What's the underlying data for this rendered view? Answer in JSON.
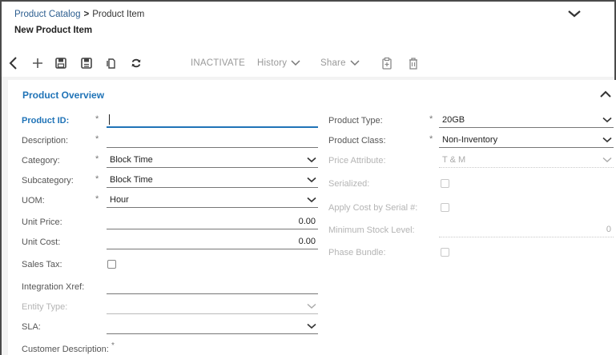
{
  "breadcrumb": {
    "parent": "Product Catalog",
    "separator": ">",
    "current": "Product Item"
  },
  "page_title": "New Product Item",
  "toolbar": {
    "inactivate_label": "INACTIVATE",
    "history_label": "History",
    "share_label": "Share"
  },
  "section": {
    "title": "Product Overview"
  },
  "fields": {
    "product_id": {
      "label": "Product ID:",
      "value": "",
      "required": "*"
    },
    "description": {
      "label": "Description:",
      "value": "",
      "required": "*"
    },
    "category": {
      "label": "Category:",
      "value": "Block Time",
      "required": "*"
    },
    "subcategory": {
      "label": "Subcategory:",
      "value": "Block Time",
      "required": "*"
    },
    "uom": {
      "label": "UOM:",
      "value": "Hour",
      "required": "*"
    },
    "unit_price": {
      "label": "Unit Price:",
      "value": "0.00"
    },
    "unit_cost": {
      "label": "Unit Cost:",
      "value": "0.00"
    },
    "sales_tax": {
      "label": "Sales Tax:",
      "checked": false
    },
    "integration_xref": {
      "label": "Integration Xref:",
      "value": ""
    },
    "entity_type": {
      "label": "Entity Type:",
      "value": ""
    },
    "sla": {
      "label": "SLA:",
      "value": ""
    },
    "customer_description": {
      "label": "Customer Description:",
      "required": "*"
    },
    "product_type": {
      "label": "Product Type:",
      "value": "20GB",
      "required": "*"
    },
    "product_class": {
      "label": "Product Class:",
      "value": "Non-Inventory",
      "required": "*"
    },
    "price_attribute": {
      "label": "Price Attribute:",
      "value": "T & M"
    },
    "serialized": {
      "label": "Serialized:",
      "checked": false
    },
    "apply_cost_by_serial": {
      "label": "Apply Cost by Serial #:",
      "checked": false
    },
    "minimum_stock_level": {
      "label": "Minimum Stock Level:",
      "value": "0"
    },
    "phase_bundle": {
      "label": "Phase Bundle:",
      "checked": false
    }
  }
}
